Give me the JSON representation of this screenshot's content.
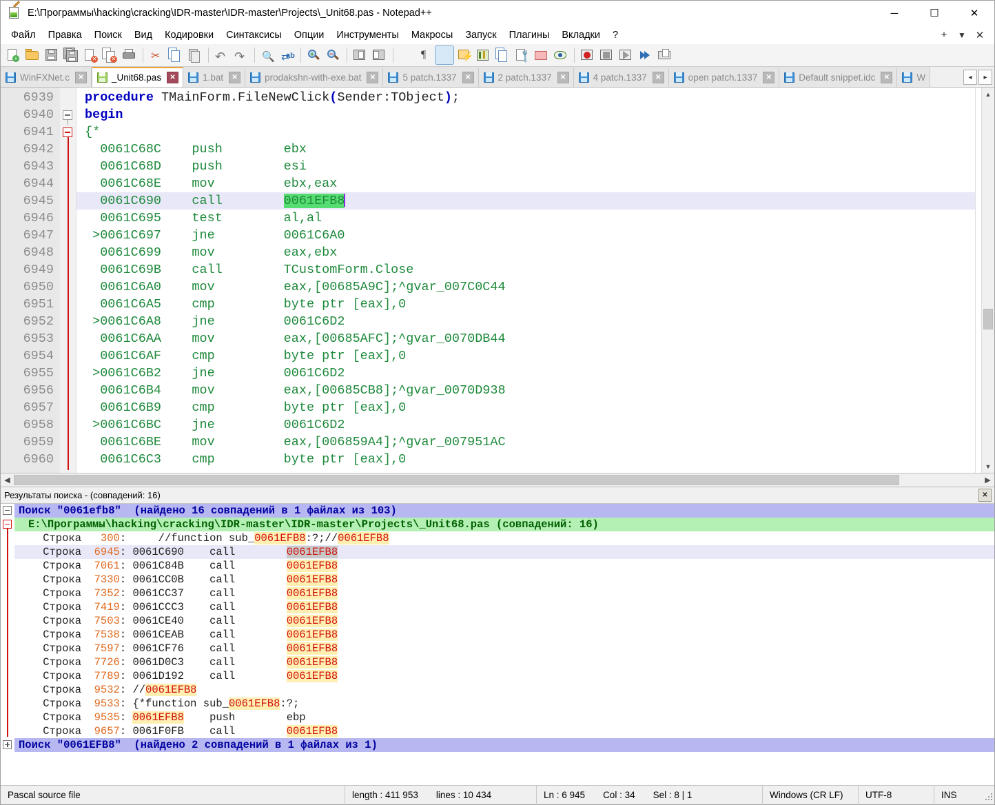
{
  "window": {
    "title": "E:\\Программы\\hacking\\cracking\\IDR-master\\IDR-master\\Projects\\_Unit68.pas - Notepad++",
    "minimize": "─",
    "maximize": "☐",
    "close": "✕"
  },
  "menu": {
    "items": [
      "Файл",
      "Правка",
      "Поиск",
      "Вид",
      "Кодировки",
      "Синтаксисы",
      "Опции",
      "Инструменты",
      "Макросы",
      "Запуск",
      "Плагины",
      "Вкладки",
      "?"
    ],
    "right": [
      "+",
      "▼",
      "✕"
    ]
  },
  "toolbar": {
    "buttons": [
      {
        "name": "new-file",
        "label": "Новый"
      },
      {
        "name": "open-file",
        "label": "Открыть"
      },
      {
        "name": "save-file",
        "label": "Сохранить"
      },
      {
        "name": "save-all",
        "label": "Сохранить всё"
      },
      {
        "name": "close-file",
        "label": "Закрыть"
      },
      {
        "name": "close-all",
        "label": "Закрыть всё"
      },
      {
        "name": "print",
        "label": "Печать"
      },
      {
        "name": "cut",
        "label": "Вырезать"
      },
      {
        "name": "copy",
        "label": "Копировать"
      },
      {
        "name": "paste",
        "label": "Вставить"
      },
      {
        "name": "undo",
        "label": "Отменить"
      },
      {
        "name": "redo",
        "label": "Повторить"
      },
      {
        "name": "find",
        "label": "Найти"
      },
      {
        "name": "replace",
        "label": "Заменить"
      },
      {
        "name": "zoom-in",
        "label": "Увеличить"
      },
      {
        "name": "zoom-out",
        "label": "Уменьшить"
      },
      {
        "name": "sync-vertical",
        "label": "Синхронная вертикальная прокрутка"
      },
      {
        "name": "sync-horizontal",
        "label": "Синхронная горизонтальная прокрутка"
      },
      {
        "name": "word-wrap",
        "label": "Перенос строк"
      },
      {
        "name": "show-all-chars",
        "label": "Отображать все символы"
      },
      {
        "name": "indent-guide",
        "label": "Направляющие отступов"
      },
      {
        "name": "user-defined-dialog",
        "label": "Пользовательский синтаксис"
      },
      {
        "name": "document-map",
        "label": "Карта документа"
      },
      {
        "name": "function-list",
        "label": "Список функций"
      },
      {
        "name": "document-switcher",
        "label": "Переключатель документов"
      },
      {
        "name": "folder-as-workspace",
        "label": "Папка как рабочая область"
      },
      {
        "name": "monitoring",
        "label": "Наблюдение"
      },
      {
        "name": "record-macro",
        "label": "Записать макрос"
      },
      {
        "name": "stop-record",
        "label": "Остановить запись"
      },
      {
        "name": "play-macro",
        "label": "Воспроизвести"
      },
      {
        "name": "run-macro-multiple",
        "label": "Воспроизвести несколько раз"
      },
      {
        "name": "run",
        "label": "Запуск"
      }
    ]
  },
  "tabs": {
    "items": [
      {
        "label": "WinFXNet.c",
        "active": false,
        "icon": "blue"
      },
      {
        "label": "_Unit68.pas",
        "active": true,
        "icon": "green"
      },
      {
        "label": "1.bat",
        "active": false,
        "icon": "blue"
      },
      {
        "label": "prodakshn-with-exe.bat",
        "active": false,
        "icon": "blue"
      },
      {
        "label": "5 patch.1337",
        "active": false,
        "icon": "blue"
      },
      {
        "label": "2 patch.1337",
        "active": false,
        "icon": "blue"
      },
      {
        "label": "4 patch.1337",
        "active": false,
        "icon": "blue"
      },
      {
        "label": "open patch.1337",
        "active": false,
        "icon": "blue"
      },
      {
        "label": "Default snippet.idc",
        "active": false,
        "icon": "blue"
      },
      {
        "label": "W",
        "active": false,
        "icon": "blue"
      }
    ],
    "close_glyph": "✕",
    "scroll_left": "◂",
    "scroll_right": "▸"
  },
  "editor": {
    "first_line": 6939,
    "lines": [
      {
        "n": 6939,
        "fold": "none",
        "current": false,
        "parts": [
          {
            "t": "kw",
            "s": "procedure"
          },
          {
            "t": "plain",
            "s": " TMainForm.FileNewClick"
          },
          {
            "t": "kw",
            "s": "("
          },
          {
            "t": "plain",
            "s": "Sender:TObject"
          },
          {
            "t": "kw",
            "s": ")"
          },
          {
            "t": "plain",
            "s": ";"
          }
        ]
      },
      {
        "n": 6940,
        "fold": "box-gray",
        "current": false,
        "parts": [
          {
            "t": "kw",
            "s": "begin"
          }
        ]
      },
      {
        "n": 6941,
        "fold": "box-red",
        "current": false,
        "parts": [
          {
            "t": "asm",
            "s": "{*"
          }
        ]
      },
      {
        "n": 6942,
        "fold": "line",
        "current": false,
        "parts": [
          {
            "t": "asm",
            "s": "  0061C68C    push        ebx"
          }
        ]
      },
      {
        "n": 6943,
        "fold": "line",
        "current": false,
        "parts": [
          {
            "t": "asm",
            "s": "  0061C68D    push        esi"
          }
        ]
      },
      {
        "n": 6944,
        "fold": "line",
        "current": false,
        "parts": [
          {
            "t": "asm",
            "s": "  0061C68E    mov         ebx,eax"
          }
        ]
      },
      {
        "n": 6945,
        "fold": "line",
        "current": true,
        "parts": [
          {
            "t": "asm",
            "s": "  0061C690    call        "
          },
          {
            "t": "sel",
            "s": "0061EFB8"
          },
          {
            "t": "caret",
            "s": ""
          }
        ]
      },
      {
        "n": 6946,
        "fold": "line",
        "current": false,
        "parts": [
          {
            "t": "asm",
            "s": "  0061C695    test        al,al"
          }
        ]
      },
      {
        "n": 6947,
        "fold": "line",
        "current": false,
        "parts": [
          {
            "t": "asm",
            "s": " >0061C697    jne         0061C6A0"
          }
        ]
      },
      {
        "n": 6948,
        "fold": "line",
        "current": false,
        "parts": [
          {
            "t": "asm",
            "s": "  0061C699    mov         eax,ebx"
          }
        ]
      },
      {
        "n": 6949,
        "fold": "line",
        "current": false,
        "parts": [
          {
            "t": "asm",
            "s": "  0061C69B    call        TCustomForm.Close"
          }
        ]
      },
      {
        "n": 6950,
        "fold": "line",
        "current": false,
        "parts": [
          {
            "t": "asm",
            "s": "  0061C6A0    mov         eax,[00685A9C];^gvar_007C0C44"
          }
        ]
      },
      {
        "n": 6951,
        "fold": "line",
        "current": false,
        "parts": [
          {
            "t": "asm",
            "s": "  0061C6A5    cmp         byte ptr [eax],0"
          }
        ]
      },
      {
        "n": 6952,
        "fold": "line",
        "current": false,
        "parts": [
          {
            "t": "asm",
            "s": " >0061C6A8    jne         0061C6D2"
          }
        ]
      },
      {
        "n": 6953,
        "fold": "line",
        "current": false,
        "parts": [
          {
            "t": "asm",
            "s": "  0061C6AA    mov         eax,[00685AFC];^gvar_0070DB44"
          }
        ]
      },
      {
        "n": 6954,
        "fold": "line",
        "current": false,
        "parts": [
          {
            "t": "asm",
            "s": "  0061C6AF    cmp         byte ptr [eax],0"
          }
        ]
      },
      {
        "n": 6955,
        "fold": "line",
        "current": false,
        "parts": [
          {
            "t": "asm",
            "s": " >0061C6B2    jne         0061C6D2"
          }
        ]
      },
      {
        "n": 6956,
        "fold": "line",
        "current": false,
        "parts": [
          {
            "t": "asm",
            "s": "  0061C6B4    mov         eax,[00685CB8];^gvar_0070D938"
          }
        ]
      },
      {
        "n": 6957,
        "fold": "line",
        "current": false,
        "parts": [
          {
            "t": "asm",
            "s": "  0061C6B9    cmp         byte ptr [eax],0"
          }
        ]
      },
      {
        "n": 6958,
        "fold": "line",
        "current": false,
        "parts": [
          {
            "t": "asm",
            "s": " >0061C6BC    jne         0061C6D2"
          }
        ]
      },
      {
        "n": 6959,
        "fold": "line",
        "current": false,
        "parts": [
          {
            "t": "asm",
            "s": "  0061C6BE    mov         eax,[006859A4];^gvar_007951AC"
          }
        ]
      },
      {
        "n": 6960,
        "fold": "line",
        "current": false,
        "parts": [
          {
            "t": "asm",
            "s": "  0061C6C3    cmp         byte ptr [eax],0"
          }
        ]
      }
    ]
  },
  "results_panel": {
    "title": "Результаты поиска - (совпадений: 16)",
    "close_glyph": "✕",
    "rows": [
      {
        "kind": "search-header",
        "fold": "minus",
        "text": "Поиск \"0061efb8\"  (найдено 16 совпадений в 1 файлах из 103)"
      },
      {
        "kind": "file-header",
        "fold": "minus-red",
        "text": "E:\\Программы\\hacking\\cracking\\IDR-master\\IDR-master\\Projects\\_Unit68.pas (совпадений: 16)"
      },
      {
        "kind": "hit",
        "current": false,
        "label": "Строка",
        "line": "300",
        "segments": [
          {
            "t": "txt",
            "s": "    //function sub_"
          },
          {
            "t": "hl",
            "s": "0061EFB8"
          },
          {
            "t": "txt",
            "s": ":?;//"
          },
          {
            "t": "hl",
            "s": "0061EFB8"
          }
        ]
      },
      {
        "kind": "hit",
        "current": true,
        "label": "Строка",
        "line": "6945",
        "segments": [
          {
            "t": "txt",
            "s": "0061C690    call        "
          },
          {
            "t": "hlsel",
            "s": "0061EFB8"
          }
        ]
      },
      {
        "kind": "hit",
        "current": false,
        "label": "Строка",
        "line": "7061",
        "segments": [
          {
            "t": "txt",
            "s": "0061C84B    call        "
          },
          {
            "t": "hl",
            "s": "0061EFB8"
          }
        ]
      },
      {
        "kind": "hit",
        "current": false,
        "label": "Строка",
        "line": "7330",
        "segments": [
          {
            "t": "txt",
            "s": "0061CC0B    call        "
          },
          {
            "t": "hl",
            "s": "0061EFB8"
          }
        ]
      },
      {
        "kind": "hit",
        "current": false,
        "label": "Строка",
        "line": "7352",
        "segments": [
          {
            "t": "txt",
            "s": "0061CC37    call        "
          },
          {
            "t": "hl",
            "s": "0061EFB8"
          }
        ]
      },
      {
        "kind": "hit",
        "current": false,
        "label": "Строка",
        "line": "7419",
        "segments": [
          {
            "t": "txt",
            "s": "0061CCC3    call        "
          },
          {
            "t": "hl",
            "s": "0061EFB8"
          }
        ]
      },
      {
        "kind": "hit",
        "current": false,
        "label": "Строка",
        "line": "7503",
        "segments": [
          {
            "t": "txt",
            "s": "0061CE40    call        "
          },
          {
            "t": "hl",
            "s": "0061EFB8"
          }
        ]
      },
      {
        "kind": "hit",
        "current": false,
        "label": "Строка",
        "line": "7538",
        "segments": [
          {
            "t": "txt",
            "s": "0061CEAB    call        "
          },
          {
            "t": "hl",
            "s": "0061EFB8"
          }
        ]
      },
      {
        "kind": "hit",
        "current": false,
        "label": "Строка",
        "line": "7597",
        "segments": [
          {
            "t": "txt",
            "s": "0061CF76    call        "
          },
          {
            "t": "hl",
            "s": "0061EFB8"
          }
        ]
      },
      {
        "kind": "hit",
        "current": false,
        "label": "Строка",
        "line": "7726",
        "segments": [
          {
            "t": "txt",
            "s": "0061D0C3    call        "
          },
          {
            "t": "hl",
            "s": "0061EFB8"
          }
        ]
      },
      {
        "kind": "hit",
        "current": false,
        "label": "Строка",
        "line": "7789",
        "segments": [
          {
            "t": "txt",
            "s": "0061D192    call        "
          },
          {
            "t": "hl",
            "s": "0061EFB8"
          }
        ]
      },
      {
        "kind": "hit",
        "current": false,
        "label": "Строка",
        "line": "9532",
        "segments": [
          {
            "t": "txt",
            "s": "//"
          },
          {
            "t": "hl",
            "s": "0061EFB8"
          }
        ]
      },
      {
        "kind": "hit",
        "current": false,
        "label": "Строка",
        "line": "9533",
        "segments": [
          {
            "t": "txt",
            "s": "{*function sub_"
          },
          {
            "t": "hl",
            "s": "0061EFB8"
          },
          {
            "t": "txt",
            "s": ":?;"
          }
        ]
      },
      {
        "kind": "hit",
        "current": false,
        "label": "Строка",
        "line": "9535",
        "segments": [
          {
            "t": "hl",
            "s": "0061EFB8"
          },
          {
            "t": "txt",
            "s": "    push        ebp"
          }
        ]
      },
      {
        "kind": "hit",
        "current": false,
        "label": "Строка",
        "line": "9657",
        "segments": [
          {
            "t": "txt",
            "s": "0061F0FB    call        "
          },
          {
            "t": "hl",
            "s": "0061EFB8"
          }
        ]
      },
      {
        "kind": "search-header",
        "fold": "plus",
        "text": "Поиск \"0061EFB8\"  (найдено 2 совпадений в 1 файлах из 1)"
      }
    ]
  },
  "statusbar": {
    "file_type": "Pascal source file",
    "length_label": "length : 411 953",
    "lines_label": "lines : 10 434",
    "ln": "Ln : 6 945",
    "col": "Col : 34",
    "sel": "Sel : 8 | 1",
    "eol": "Windows (CR LF)",
    "encoding": "UTF-8",
    "mode": "INS"
  }
}
